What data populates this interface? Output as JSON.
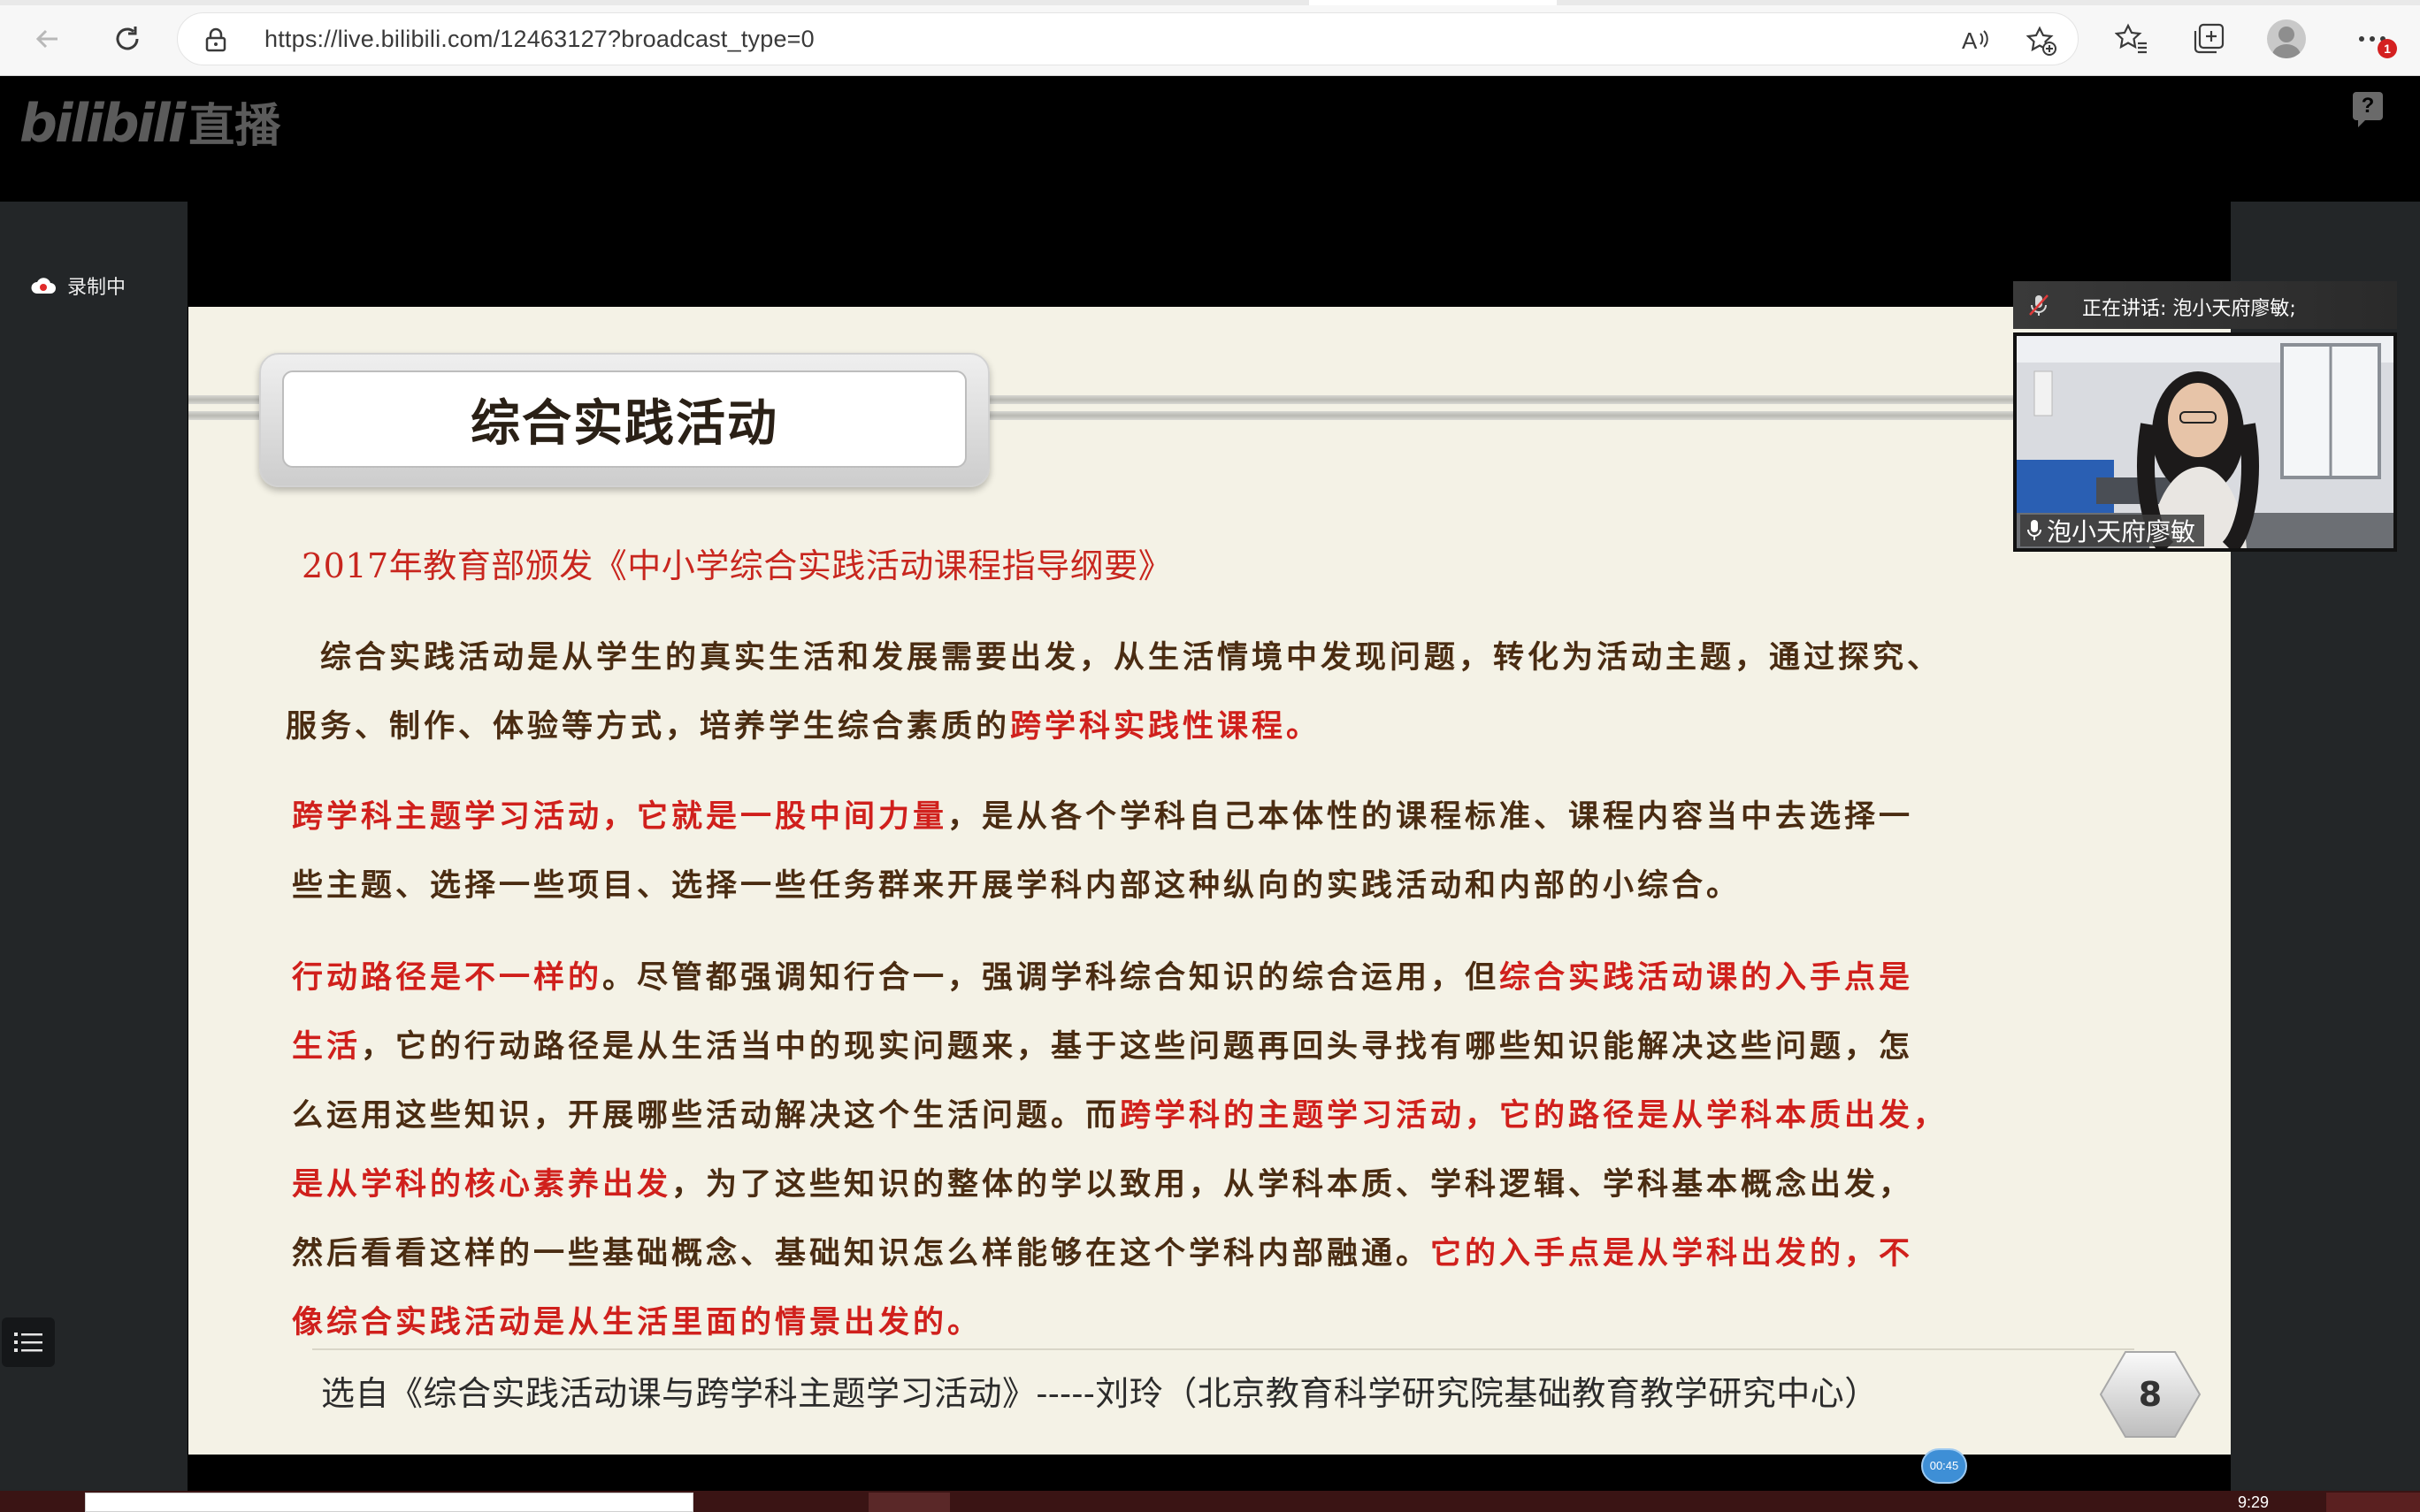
{
  "browser": {
    "url": "https://live.bilibili.com/12463127?broadcast_type=0",
    "notification_count": "1"
  },
  "site": {
    "logo_text": "bilibili",
    "logo_suffix": "直播",
    "help_label": "?"
  },
  "sidebar": {
    "recording_label": "录制中"
  },
  "slide": {
    "title": "综合实践活动",
    "subtitle": "2017年教育部颁发《中小学综合实践活动课程指导纲要》",
    "para1": {
      "line1": "　综合实践活动是从学生的真实生活和发展需要出发，从生活情境中发现问题，转化为活动主题，通过探究、",
      "line2_a": "服务、制作、体验等方式，培养学生综合素质的",
      "line2_b": "跨学科实践性课程。"
    },
    "para2": {
      "line1_a": "跨学科主题学习活动，它就是一股中间力量",
      "line1_b": "，是从各个学科自己本体性的课程标准、课程内容当中去选择一",
      "line2": "些主题、选择一些项目、选择一些任务群来开展学科内部这种纵向的实践活动和内部的小综合。"
    },
    "para3": {
      "line1_a": "行动路径是不一样的",
      "line1_b": "。尽管都强调知行合一，强调学科综合知识的综合运用，但",
      "line1_c": "综合实践活动课的入手点是",
      "line2_a": "生活",
      "line2_b": "，它的行动路径是从生活当中的现实问题来，基于这些问题再回头寻找有哪些知识能解决这些问题，怎",
      "line3_a": "么运用这些知识，开展哪些活动解决这个生活问题。而",
      "line3_b": "跨学科的主题学习活动，它的路径是从学科本质出发，",
      "line4_a": "是从学科的核心素养出发",
      "line4_b": "，为了这些知识的整体的学以致用，从学科本质、学科逻辑、学科基本概念出发，",
      "line5_a": "然后看看这样的一些基础概念、基础知识怎么样能够在这个学科内部融通。",
      "line5_b": "它的入手点是从学科出发的，不",
      "line6": "像综合实践活动是从生活里面的情景出发的。"
    },
    "source": "选自《综合实践活动课与跨学科主题学习活动》-----刘玲（北京教育科学研究院基础教育教学研究中心）",
    "page_number": "8"
  },
  "speaker": {
    "speaking_label": "正在讲话: 泡小天府廖敏;",
    "name": "泡小天府廖敏"
  },
  "player": {
    "progress_time": "00:45"
  },
  "taskbar": {
    "clock": "9:29"
  },
  "colors": {
    "slide_red": "#d0201c",
    "slide_text": "#4a2c12",
    "slide_bg": "#f4f2e6",
    "panel_bg": "#232628"
  }
}
